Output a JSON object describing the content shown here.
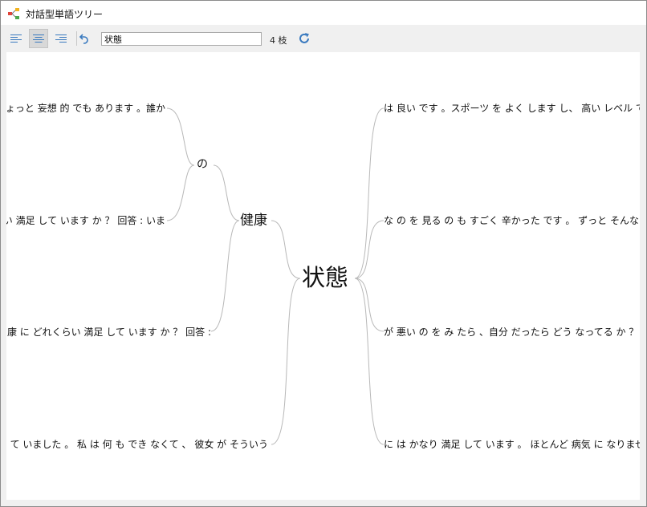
{
  "window": {
    "title": "対話型単語ツリー"
  },
  "toolbar": {
    "align_left_icon": "align-left-icon",
    "align_center_icon": "align-center-icon",
    "align_right_icon": "align-right-icon",
    "undo_icon": "undo-icon",
    "search_value": "状態",
    "count_label": "4 枝",
    "refresh_icon": "refresh-icon"
  },
  "tree": {
    "root": "状態",
    "left_branch": "健康",
    "left_sub": "の",
    "left_leaves": [
      "ちょっと 妄想 的 でも あります 。誰か",
      "い 満足 して います か ？ 回答 : いま",
      "康 に どれくらい 満足 して います か ？ 回答 :",
      "渇っ て いました 。 私 は 何 も でき なくて 、 彼女 が そういう"
    ],
    "right_leaves": [
      "は 良い です 。スポーツ を よく します し、 高い レベル で 競争",
      "な の を 見る の も すごく 辛かった です 。 ずっと そんな だった の",
      "が 悪い の を み たら 、自分 だったら どう なってる か ？ って 心",
      "に は かなり 満足 して います 。 ほとんど 病気 に なりません し"
    ]
  },
  "colors": {
    "accent_blue": "#3a7abf",
    "edge_gray": "#b8b8b8"
  }
}
